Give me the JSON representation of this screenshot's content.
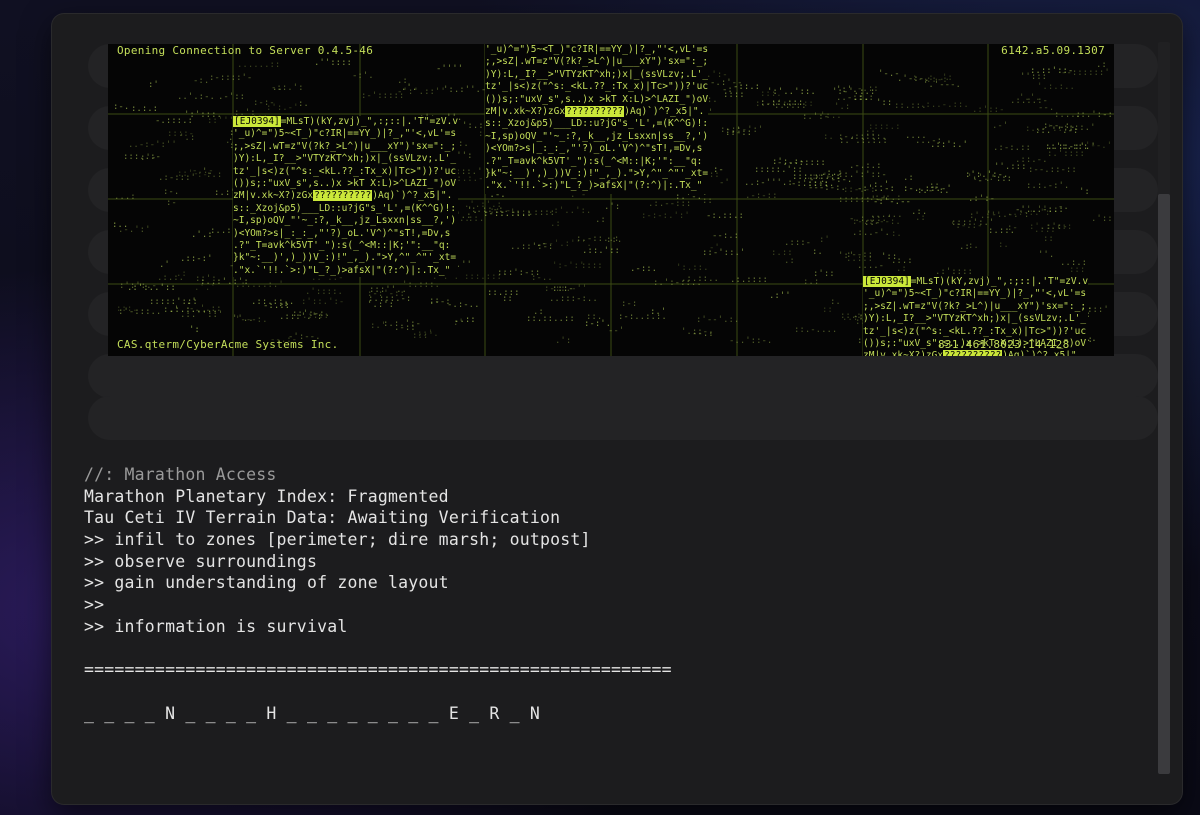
{
  "banner": {
    "title": "Opening Connection to Server 0.4.5-46",
    "build": "6142.a5.09.1307",
    "vendor": "CAS.qterm/CyberAcme Systems Inc.",
    "coords": "831.461.8023.14.128",
    "block_tag": "[EJ0394]",
    "block_mask": "??????????",
    "blocks": [
      {
        "lines": [
          "=MLsT)(kY,zvj)_\",:;::|.'T\"=zV.v",
          "'_u)^=\")5~<T_)\"c?IR|==YY_)|?_,\"'<,vL'=s",
          ";,>sZ|.wT=z\"V(?k?_>L^)|u___xY\")'sx=\":_;",
          ")Y):L,_I?__>\"VTYzKT^xh;)x|_(ssVLzv;.L'_",
          "tz'_|s<)z(\"^s:_<kL.??_:Tx_x)|Tc>\"))?'uc",
          "())s;:\"uxV_s\",s..)x >kT X:L)>^LAZI_\")oV",
          "zM|v.xk~X?)zGx",
          ")Aq)`)^?_x5|\".",
          "s::_Xzoj&p5)___LD::u?jG\"s_'L',=(K^^G)!:",
          "~I,sp)oQV_\"'~_:?,_k__,jz_Lsxxn|ss__?,')",
          ")<YOm?>s|_:_:_,\"'?)_oL.'V^)^\"sT!,=Dv,s",
          ".?\"_T=avk^k5VT'_\"):s(_^<M::|K;'\":__\"q:",
          "}k\"~:__)',)_))V_:)!\"_,_).\">Y,^\"_^\"'_xt=",
          ".\"x.`'!!.`>:)\"L_?_)>afsX|\"(?:^)|:.Tx_\""
        ]
      }
    ]
  },
  "log": {
    "lines": [
      "//: Marathon Access",
      "Marathon Planetary Index: Fragmented",
      "Tau Ceti IV Terrain Data: Awaiting Verification",
      ">> infil to zones [perimeter; dire marsh; outpost]",
      ">> observe surroundings",
      ">> gain understanding of zone layout",
      ">>",
      ">> information is survival",
      "",
      "==========================================================",
      "",
      "_ _ _ _ N _ _ _ _ H _ _ _ _ _ _ _ _ E _ R _ N"
    ]
  },
  "colors": {
    "terminal_green": "#c4df5a",
    "highlight": "#cbe83a",
    "panel": "#1c1c1e",
    "text": "#e4e4e4"
  }
}
